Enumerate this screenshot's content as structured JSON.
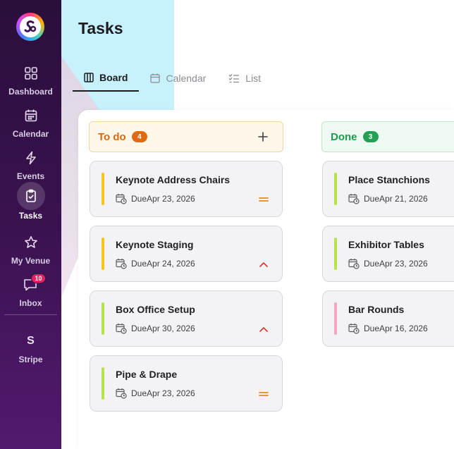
{
  "page": {
    "title": "Tasks"
  },
  "sidebar": {
    "items": [
      {
        "label": "Dashboard",
        "icon": "grid-icon"
      },
      {
        "label": "Calendar",
        "icon": "calendar-icon"
      },
      {
        "label": "Events",
        "icon": "bolt-icon"
      },
      {
        "label": "Tasks",
        "icon": "clipboard-check-icon",
        "active": true
      },
      {
        "label": "My Venue",
        "icon": "star-icon"
      },
      {
        "label": "Inbox",
        "icon": "message-icon",
        "badge": "10"
      }
    ],
    "integration": {
      "letter": "S",
      "label": "Stripe"
    }
  },
  "tabs": [
    {
      "label": "Board",
      "icon": "board-icon",
      "active": true
    },
    {
      "label": "Calendar",
      "icon": "calendar-icon"
    },
    {
      "label": "List",
      "icon": "checklist-icon"
    }
  ],
  "columns": [
    {
      "title": "To do",
      "count": "4",
      "color": "#d36a12",
      "cards": [
        {
          "title": "Keynote Address Chairs",
          "due": "DueApr 23, 2026",
          "bar_color": "#f5c518",
          "priority": "medium"
        },
        {
          "title": "Keynote Staging",
          "due": "DueApr 24, 2026",
          "bar_color": "#f5c518",
          "priority": "high"
        },
        {
          "title": "Box Office Setup",
          "due": "DueApr 30, 2026",
          "bar_color": "#b7e34a",
          "priority": "high"
        },
        {
          "title": "Pipe & Drape",
          "due": "DueApr 23, 2026",
          "bar_color": "#b7e34a",
          "priority": "medium"
        }
      ]
    },
    {
      "title": "Done",
      "count": "3",
      "color": "#1f9a4e",
      "cards": [
        {
          "title": "Place Stanchions",
          "due": "DueApr 21, 2026",
          "bar_color": "#b7e34a"
        },
        {
          "title": "Exhibitor Tables",
          "due": "DueApr 23, 2026",
          "bar_color": "#b7e34a"
        },
        {
          "title": "Bar Rounds",
          "due": "DueApr 16, 2026",
          "bar_color": "#f2a6c6"
        }
      ]
    }
  ]
}
